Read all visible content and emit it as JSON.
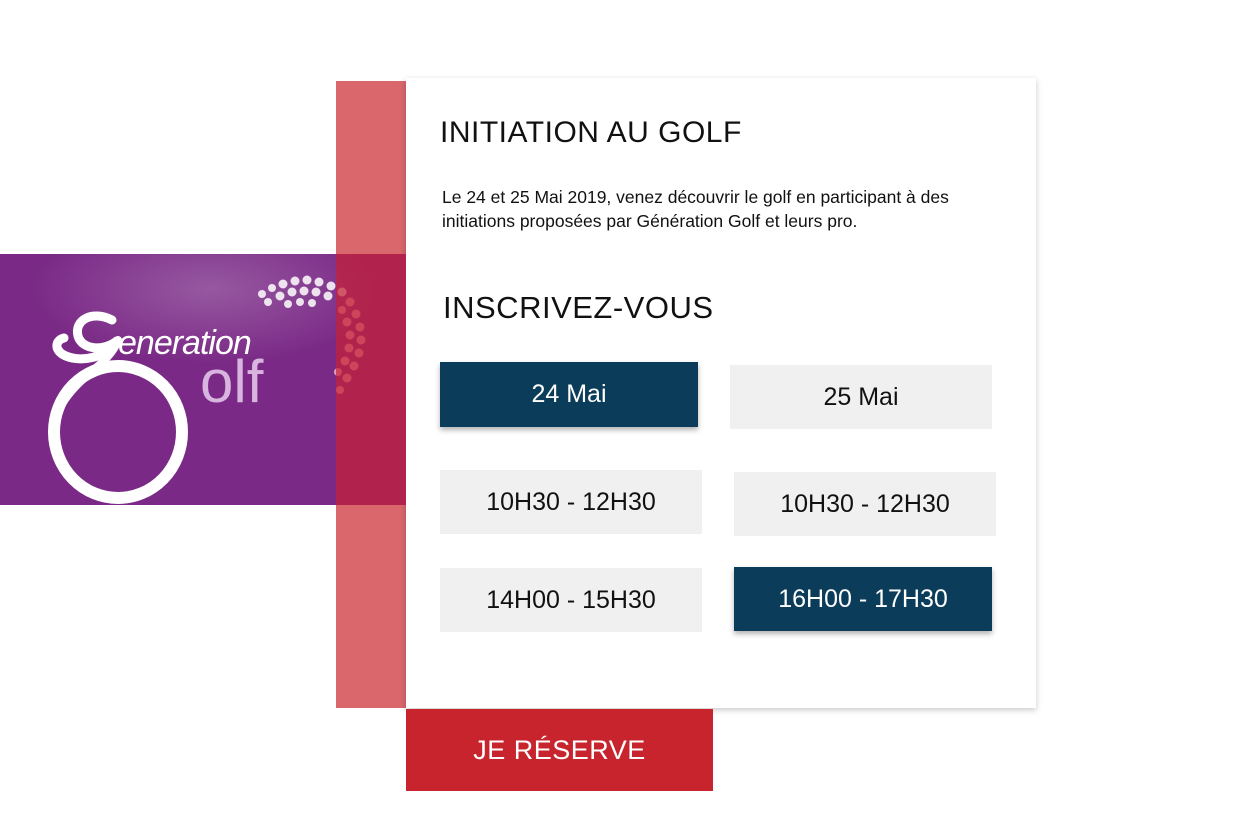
{
  "logo": {
    "text_top": "eneration",
    "text_bottom": "olf",
    "colors": {
      "background": "#7a2a86",
      "accent": "#d9676b"
    }
  },
  "card": {
    "title": "INITIATION AU GOLF",
    "description": "Le 24 et 25 Mai 2019, venez découvrir le golf en participant à des initiations proposées par Génération Golf et leurs pro.",
    "subtitle": "INSCRIVEZ-VOUS"
  },
  "days": [
    {
      "label": "24 Mai",
      "selected": true
    },
    {
      "label": "25 Mai",
      "selected": false
    }
  ],
  "slots": {
    "day1": [
      {
        "label": "10H30 - 12H30",
        "selected": false
      },
      {
        "label": "14H00 - 15H30",
        "selected": false
      }
    ],
    "day2": [
      {
        "label": "10H30 - 12H30",
        "selected": false
      },
      {
        "label": "16H00 - 17H30",
        "selected": true
      }
    ]
  },
  "reserve": {
    "label": "JE RÉSERVE"
  },
  "colors": {
    "selected": "#0b3d5b",
    "unselected": "#f0f0f0",
    "reserve": "#c8242e"
  }
}
